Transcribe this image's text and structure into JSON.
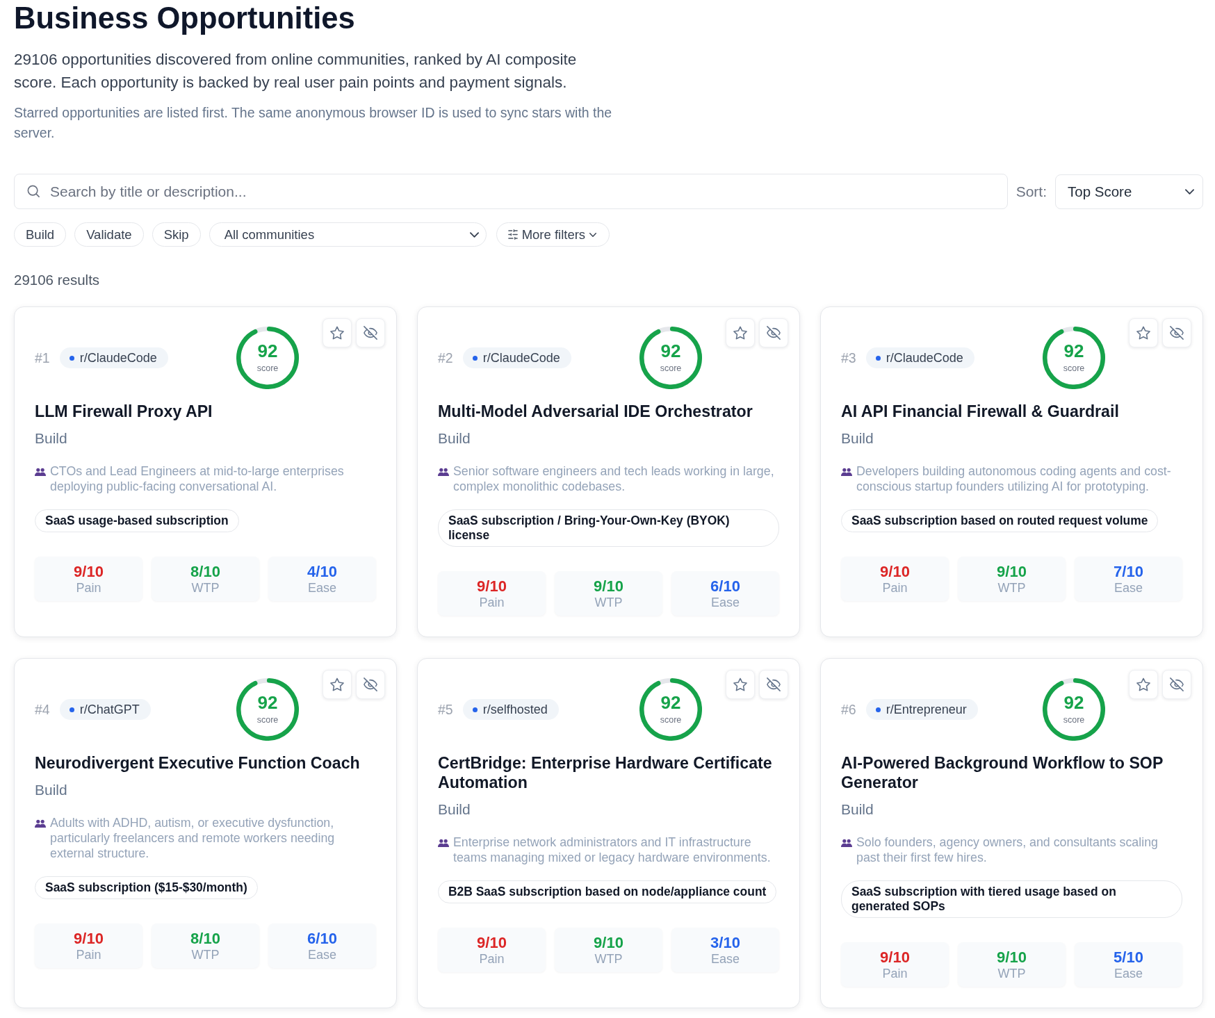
{
  "page": {
    "title": "Business Opportunities",
    "description": "29106 opportunities discovered from online communities, ranked by AI composite score. Each opportunity is backed by real user pain points and payment signals.",
    "note": "Starred opportunities are listed first. The same anonymous browser ID is used to sync stars with the server."
  },
  "search": {
    "placeholder": "Search by title or description..."
  },
  "sort": {
    "label": "Sort:",
    "value": "Top Score"
  },
  "filters": {
    "chips": [
      {
        "label": "Build",
        "selected": false
      },
      {
        "label": "Validate",
        "selected": false
      },
      {
        "label": "Skip",
        "selected": false
      }
    ],
    "community_select": {
      "value": "All communities"
    },
    "more_filters": {
      "label": "More filters"
    }
  },
  "results_count": "29106 results",
  "cards": [
    {
      "rank": "#1",
      "community": "r/ClaudeCode",
      "score": {
        "value": "92",
        "label": "score"
      },
      "starred": false,
      "title": "LLM Firewall Proxy API",
      "category": "Build",
      "audience": "CTOs and Lead Engineers at mid-to-large enterprises deploying public-facing conversational AI.",
      "monetization": "SaaS usage-based subscription",
      "metrics": [
        {
          "kind": "pain",
          "value": "9/10",
          "label": "Pain"
        },
        {
          "kind": "wtp",
          "value": "8/10",
          "label": "WTP"
        },
        {
          "kind": "ease",
          "value": "4/10",
          "label": "Ease"
        }
      ]
    },
    {
      "rank": "#2",
      "community": "r/ClaudeCode",
      "score": {
        "value": "92",
        "label": "score"
      },
      "starred": false,
      "title": "Multi-Model Adversarial IDE Orchestrator",
      "category": "Build",
      "audience": "Senior software engineers and tech leads working in large, complex monolithic codebases.",
      "monetization": "SaaS subscription / Bring-Your-Own-Key (BYOK) license",
      "metrics": [
        {
          "kind": "pain",
          "value": "9/10",
          "label": "Pain"
        },
        {
          "kind": "wtp",
          "value": "9/10",
          "label": "WTP"
        },
        {
          "kind": "ease",
          "value": "6/10",
          "label": "Ease"
        }
      ]
    },
    {
      "rank": "#3",
      "community": "r/ClaudeCode",
      "score": {
        "value": "92",
        "label": "score"
      },
      "starred": false,
      "title": "AI API Financial Firewall & Guardrail",
      "category": "Build",
      "audience": "Developers building autonomous coding agents and cost-conscious startup founders utilizing AI for prototyping.",
      "monetization": "SaaS subscription based on routed request volume",
      "metrics": [
        {
          "kind": "pain",
          "value": "9/10",
          "label": "Pain"
        },
        {
          "kind": "wtp",
          "value": "9/10",
          "label": "WTP"
        },
        {
          "kind": "ease",
          "value": "7/10",
          "label": "Ease"
        }
      ]
    },
    {
      "rank": "#4",
      "community": "r/ChatGPT",
      "score": {
        "value": "92",
        "label": "score"
      },
      "starred": false,
      "title": "Neurodivergent Executive Function Coach",
      "category": "Build",
      "audience": "Adults with ADHD, autism, or executive dysfunction, particularly freelancers and remote workers needing external structure.",
      "monetization": "SaaS subscription ($15-$30/month)",
      "metrics": [
        {
          "kind": "pain",
          "value": "9/10",
          "label": "Pain"
        },
        {
          "kind": "wtp",
          "value": "8/10",
          "label": "WTP"
        },
        {
          "kind": "ease",
          "value": "6/10",
          "label": "Ease"
        }
      ]
    },
    {
      "rank": "#5",
      "community": "r/selfhosted",
      "score": {
        "value": "92",
        "label": "score"
      },
      "starred": false,
      "title": "CertBridge: Enterprise Hardware Certificate Automation",
      "category": "Build",
      "audience": "Enterprise network administrators and IT infrastructure teams managing mixed or legacy hardware environments.",
      "monetization": "B2B SaaS subscription based on node/appliance count",
      "metrics": [
        {
          "kind": "pain",
          "value": "9/10",
          "label": "Pain"
        },
        {
          "kind": "wtp",
          "value": "9/10",
          "label": "WTP"
        },
        {
          "kind": "ease",
          "value": "3/10",
          "label": "Ease"
        }
      ]
    },
    {
      "rank": "#6",
      "community": "r/Entrepreneur",
      "score": {
        "value": "92",
        "label": "score"
      },
      "starred": false,
      "title": "AI-Powered Background Workflow to SOP Generator",
      "category": "Build",
      "audience": "Solo founders, agency owners, and consultants scaling past their first few hires.",
      "monetization": "SaaS subscription with tiered usage based on generated SOPs",
      "metrics": [
        {
          "kind": "pain",
          "value": "9/10",
          "label": "Pain"
        },
        {
          "kind": "wtp",
          "value": "9/10",
          "label": "WTP"
        },
        {
          "kind": "ease",
          "value": "5/10",
          "label": "Ease"
        }
      ]
    }
  ]
}
